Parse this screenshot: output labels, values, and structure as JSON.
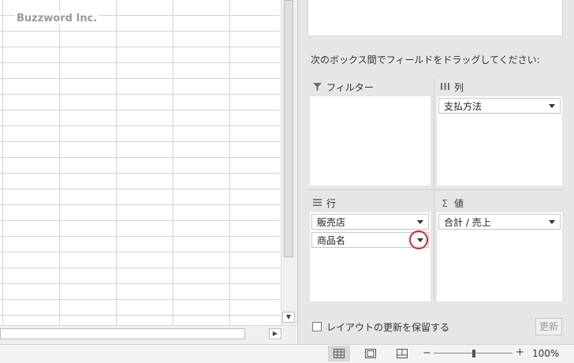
{
  "watermark": "Buzzword Inc.",
  "pivot_pane": {
    "instruction": "次のボックス間でフィールドをドラッグしてください:",
    "areas": {
      "filters": {
        "label": "フィルター",
        "icon": "filter-icon",
        "fields": []
      },
      "columns": {
        "label": "列",
        "icon": "columns-icon",
        "fields": [
          "支払方法"
        ]
      },
      "rows": {
        "label": "行",
        "icon": "rows-icon",
        "fields": [
          "販売店",
          "商品名"
        ]
      },
      "values": {
        "label": "値",
        "icon": "sigma-icon",
        "fields": [
          "合計 / 売上"
        ]
      }
    },
    "defer_update_label": "レイアウトの更新を保留する",
    "update_button": "更新",
    "highlight_color": "#d9262b"
  },
  "statusbar": {
    "views": [
      "normal-view",
      "page-layout-view",
      "page-break-view"
    ],
    "zoom_minus": "−",
    "zoom_plus": "+",
    "zoom_level": "100%",
    "zoom_fraction": 0.5
  }
}
